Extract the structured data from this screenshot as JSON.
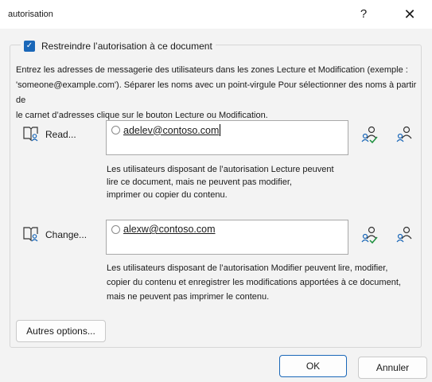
{
  "window": {
    "title": "autorisation",
    "help": "?",
    "close": "✕"
  },
  "restrict": {
    "label": "Restreindre l’autorisation à ce document",
    "checked": true
  },
  "intro": {
    "line1": "Entrez les adresses de messagerie des utilisateurs dans les zones Lecture et Modification (exemple :",
    "line2": "'someone@example.com'). Séparer les noms avec un point-virgule Pour sélectionner des noms à partir de",
    "line3": "le carnet d’adresses clique sur le bouton Lecture ou Modification."
  },
  "read": {
    "label": "Read...",
    "address": "adelev@contoso.com",
    "desc1": "Les utilisateurs disposant de l’autorisation Lecture peuvent",
    "desc2": "lire ce document, mais ne peuvent pas modifier,",
    "desc3": "imprimer ou copier du contenu."
  },
  "change": {
    "label": "Change...",
    "address": "alexw@contoso.com",
    "desc1": "Les utilisateurs disposant de l’autorisation Modifier peuvent lire, modifier,",
    "desc2": "copier du contenu et enregistrer les modifications apportées à ce document,",
    "desc3": "mais ne peuvent pas imprimer le contenu."
  },
  "buttons": {
    "more": "Autres options...",
    "ok": "OK",
    "cancel": "Annuler"
  },
  "colors": {
    "accent": "#1a67b8",
    "check_person": "#1a8f3c"
  }
}
